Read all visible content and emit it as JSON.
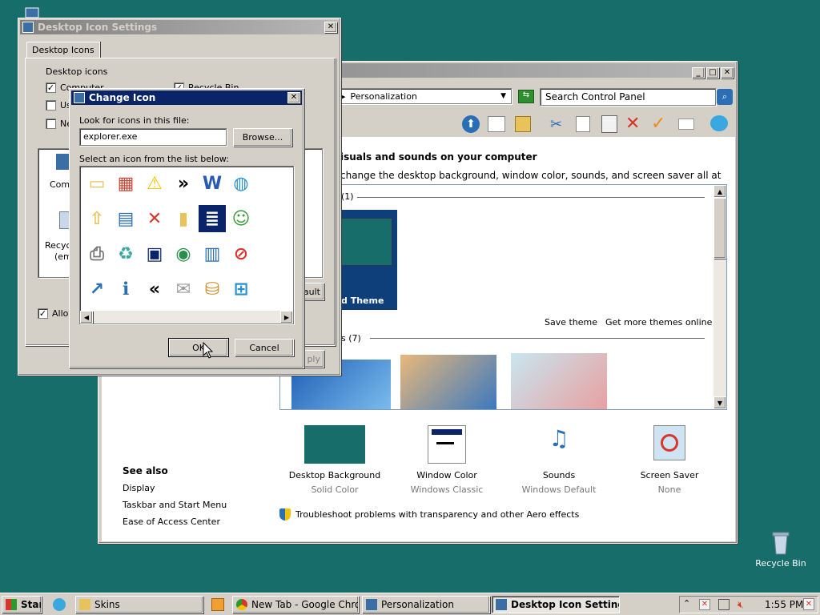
{
  "desktop": {
    "recycle_bin_label": "Recycle Bin"
  },
  "control_panel": {
    "address": "Personalization",
    "search_placeholder": "Search Control Panel",
    "heading": "isuals and sounds on your computer",
    "subheading": "change the desktop background, window color, sounds, and screen saver all at once.",
    "my_themes": "(1)",
    "installed_themes": "s (7)",
    "unsaved_theme": "d Theme",
    "save_theme": "Save theme",
    "more_themes": "Get more themes online",
    "see_also": "See also",
    "see_also_links": [
      "Display",
      "Taskbar and Start Menu",
      "Ease of Access Center"
    ],
    "items": [
      {
        "title": "Desktop Background",
        "sub": "Solid Color"
      },
      {
        "title": "Window Color",
        "sub": "Windows Classic"
      },
      {
        "title": "Sounds",
        "sub": "Windows Default"
      },
      {
        "title": "Screen Saver",
        "sub": "None"
      }
    ],
    "troubleshoot": "Troubleshoot problems with transparency and other Aero effects"
  },
  "desktop_icon_settings": {
    "title": "Desktop Icon Settings",
    "tab": "Desktop Icons",
    "group": "Desktop icons",
    "checks": [
      {
        "label": "Computer",
        "checked": true
      },
      {
        "label": "Us",
        "checked": false
      },
      {
        "label": "Ne",
        "checked": false
      },
      {
        "label": "Recycle Bin",
        "checked": true
      }
    ],
    "preview_labels": [
      "Comp",
      "Recyc",
      "(em"
    ],
    "restore_btn": "ault",
    "allow": "Allov",
    "apply_btn": "ply"
  },
  "change_icon": {
    "title": "Change Icon",
    "look_label": "Look for icons in this file:",
    "file_value": "explorer.exe",
    "browse": "Browse...",
    "list_label": "Select an icon from the list below:",
    "ok": "OK",
    "cancel": "Cancel",
    "selected_index": 10
  },
  "taskbar": {
    "start": "Start",
    "tasks": [
      {
        "label": "Skins",
        "active": false
      },
      {
        "label": "New Tab - Google Chrome",
        "active": false
      },
      {
        "label": "Personalization",
        "active": false
      },
      {
        "label": "Desktop Icon Settings",
        "active": true
      }
    ],
    "clock": "1:55 PM"
  },
  "colors": {
    "desktop": "#176d6a",
    "titlebar_active": "#0a246a",
    "theme_tile": "#0e3f7a"
  }
}
